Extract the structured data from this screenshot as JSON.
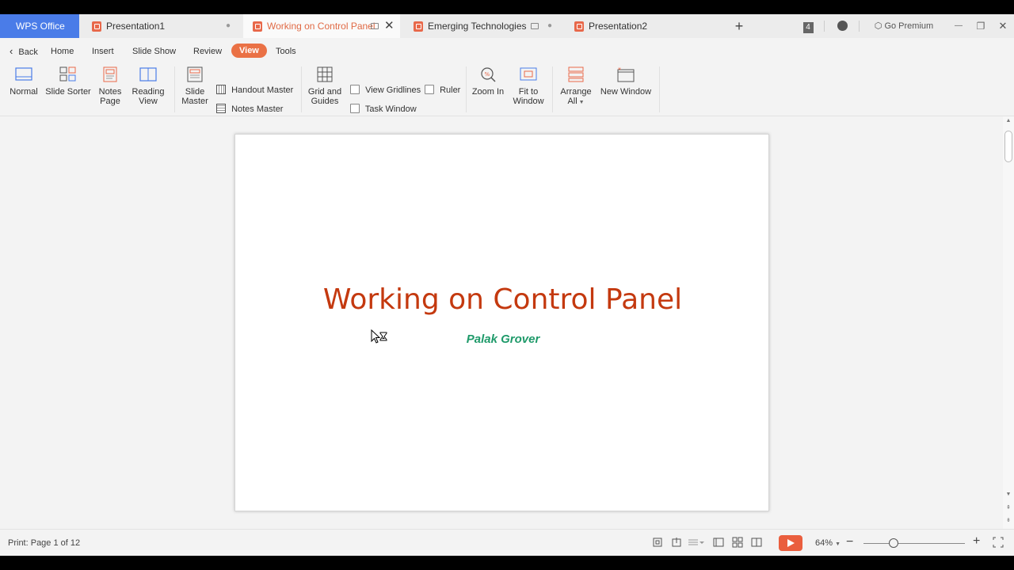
{
  "titlebar": {
    "wps_label": "WPS Office",
    "tabs": [
      {
        "label": "Presentation1"
      },
      {
        "label": "Working on Control Panel"
      },
      {
        "label": "Emerging Technologies"
      },
      {
        "label": "Presentation2"
      }
    ],
    "tab_count": "4",
    "go_premium": "Go Premium",
    "new_tab_glyph": "+",
    "minimize_glyph": "—",
    "restore_glyph": "❐",
    "close_glyph": "✕"
  },
  "menubar": {
    "back": "Back",
    "items": [
      "Home",
      "Insert",
      "Slide Show",
      "Review",
      "View",
      "Tools"
    ],
    "active": "View"
  },
  "ribbon": {
    "normal": "Normal",
    "slide_sorter": "Slide Sorter",
    "notes_page_1": "Notes",
    "notes_page_2": "Page",
    "reading_view_1": "Reading",
    "reading_view_2": "View",
    "slide_master_1": "Slide",
    "slide_master_2": "Master",
    "handout_master": "Handout Master",
    "notes_master": "Notes Master",
    "grid_guides_1": "Grid and",
    "grid_guides_2": "Guides",
    "view_gridlines": "View Gridlines",
    "ruler": "Ruler",
    "task_window": "Task Window",
    "zoom_in": "Zoom In",
    "fit_window_1": "Fit to",
    "fit_window_2": "Window",
    "arrange_all_1": "Arrange",
    "arrange_all_2": "All",
    "new_window": "New Window"
  },
  "slide": {
    "title": "Working on Control Panel",
    "subtitle": "Palak Grover"
  },
  "statusbar": {
    "print_info": "Print: Page 1 of 12",
    "zoom_level": "64%",
    "zoom_fraction": 0.3
  },
  "colors": {
    "accent": "#ea7145",
    "wps_blue": "#4a7ce8",
    "title_red": "#c4390f",
    "subtitle_green": "#1f9a6a"
  }
}
